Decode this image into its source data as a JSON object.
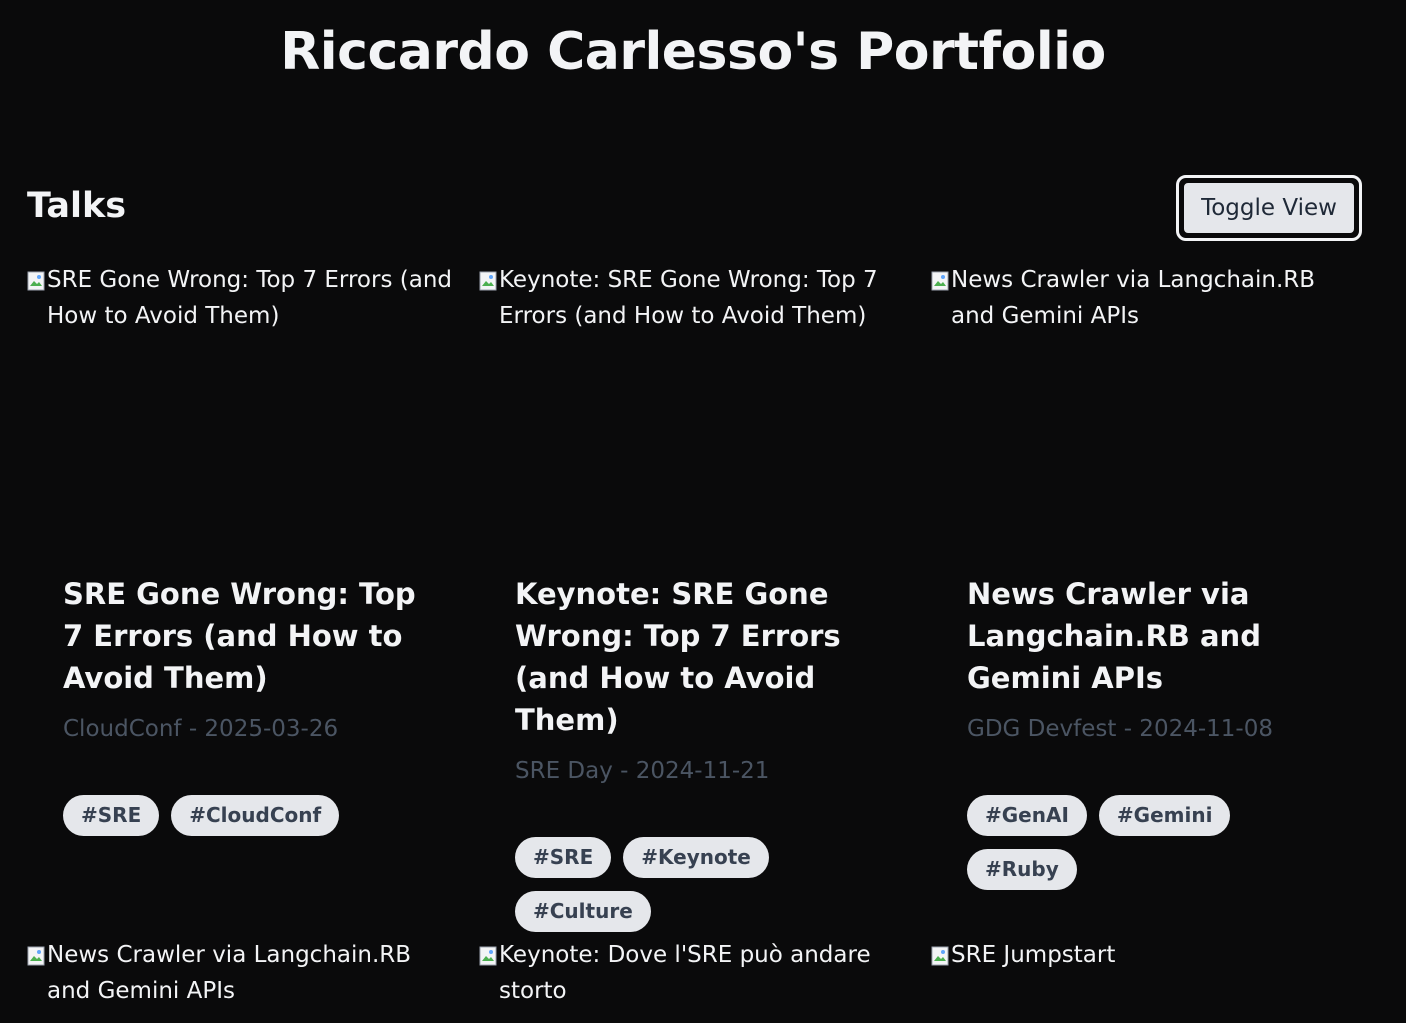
{
  "page": {
    "title": "Riccardo Carlesso's Portfolio"
  },
  "section": {
    "title": "Talks",
    "toggle_label": "Toggle View"
  },
  "talks": [
    {
      "image_alt": "SRE Gone Wrong: Top 7 Errors (and How to Avoid Them)",
      "title": "SRE Gone Wrong: Top 7 Errors (and How to Avoid Them)",
      "meta": "CloudConf - 2025-03-26",
      "tags": [
        "#SRE",
        "#CloudConf"
      ]
    },
    {
      "image_alt": "Keynote: SRE Gone Wrong: Top 7 Errors (and How to Avoid Them)",
      "title": "Keynote: SRE Gone Wrong: Top 7 Errors (and How to Avoid Them)",
      "meta": "SRE Day - 2024-11-21",
      "tags": [
        "#SRE",
        "#Keynote",
        "#Culture"
      ]
    },
    {
      "image_alt": "News Crawler via Langchain.RB and Gemini APIs",
      "title": "News Crawler via Langchain.RB and Gemini APIs",
      "meta": "GDG Devfest - 2024-11-08",
      "tags": [
        "#GenAI",
        "#Gemini",
        "#Ruby"
      ]
    },
    {
      "image_alt": "News Crawler via Langchain.RB and Gemini APIs"
    },
    {
      "image_alt": "Keynote: Dove l'SRE può andare storto"
    },
    {
      "image_alt": "SRE Jumpstart"
    }
  ],
  "colors": {
    "background": "#0a0a0b",
    "text": "#f3f4f6",
    "meta": "#4b5563",
    "tag_bg": "#e5e7eb",
    "tag_text": "#374151"
  },
  "icons": {
    "broken_image": "broken-image-icon"
  }
}
